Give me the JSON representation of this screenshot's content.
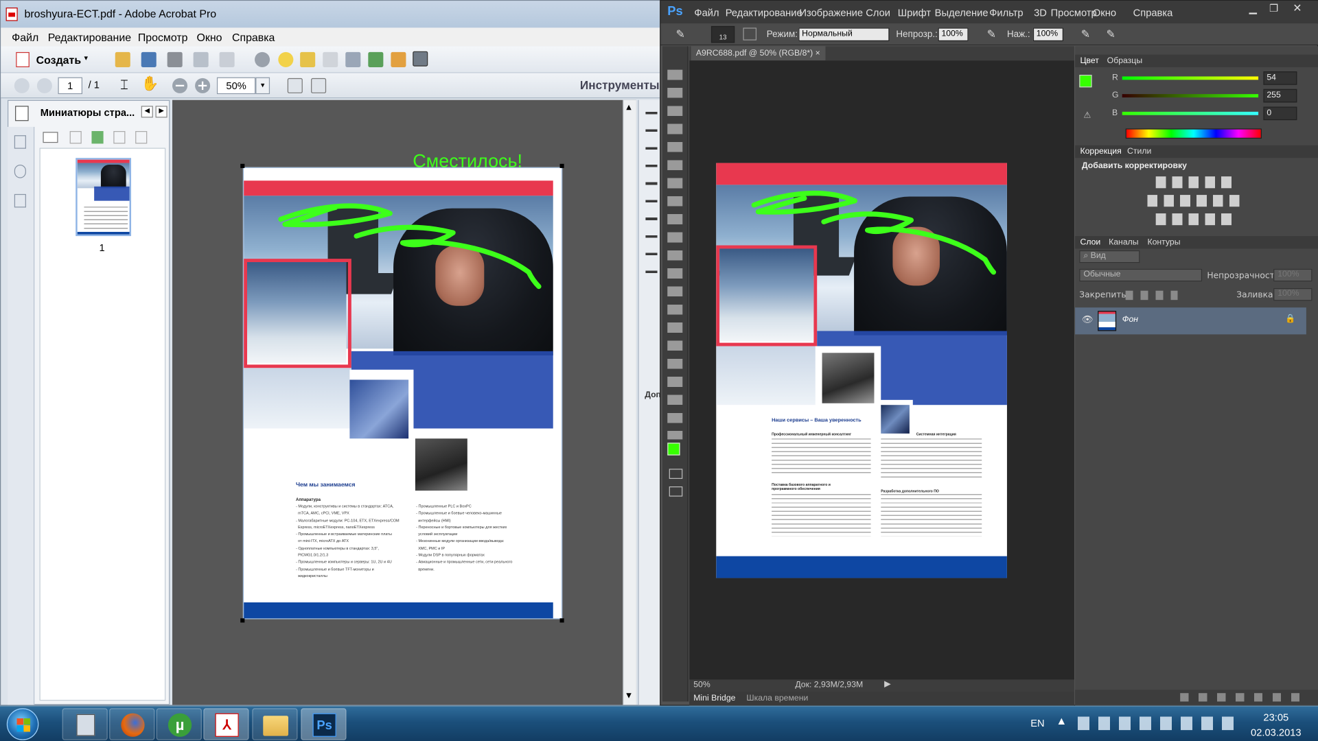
{
  "acrobat": {
    "title": "broshyura-ECT.pdf - Adobe Acrobat Pro",
    "menu": [
      "Файл",
      "Редактирование",
      "Просмотр",
      "Окно",
      "Справка"
    ],
    "create_label": "Создать",
    "page_current": "1",
    "page_total": "/ 1",
    "zoom": "50%",
    "tools_label": "Инструменты",
    "thumbnails_title": "Миниатюры стра...",
    "thumb_page_number": "1",
    "annotation": "Сместилось!",
    "right_pane_letter": "Доп"
  },
  "brochure": {
    "left_heading": "Чем мы занимаемся",
    "left_subheading": "Аппаратура",
    "left_col1": [
      "- Модули, конструктивы и системы в стандартах: ATCA,",
      "  mTCA, AMC, cPCI, VME, VPX",
      "- Малогабаритные модули: PC-104, ETX, ETXexpress/COM",
      "  Express, microETXexpress, nanoETXexpress",
      "- Промышленные и встраиваемые материнские платы",
      "  от mini-ITX, microATX до ATX",
      "- Одноплатные компьютеры в стандартах: 3,5\",",
      "  PICMG1.0/1.2/1.3",
      "- Промышленные компьютеры и серверы: 1U, 2U и 4U",
      "- Промышленные и боевые TFT-мониторы и",
      "  жидкокристаллы"
    ],
    "left_col2": [
      "- Промышленные PLC и BoxPC",
      "- Промышленные и боевые человеко-машинные",
      "  интерфейсы (HMI)",
      "- Переносные и бортовые компьютеры для жестких",
      "  условий эксплуатации",
      "- Мезонинные модули организации ввода/вывода:",
      "  XMC, PMC и IP",
      "- Модули DSP в популярных форматах",
      "- Авиационные и промышленные сети, сети реального",
      "  времени."
    ],
    "right_heading": "Наши сервисы – Ваша уверенность",
    "right_sections": [
      {
        "title": "Профессиональный инженерный консалтинг",
        "lines": 8
      },
      {
        "title": "Системная интеграция",
        "lines": 9
      },
      {
        "title": "Поставка базового аппаратного и программного обеспечения",
        "lines": 9
      },
      {
        "title": "Разработка дополнительного ПО",
        "lines": 9
      }
    ]
  },
  "photoshop": {
    "logo": "Ps",
    "menu": [
      "Файл",
      "Редактирование",
      "Изображение",
      "Слои",
      "Шрифт",
      "Выделение",
      "Фильтр",
      "3D",
      "Просмотр",
      "Окно",
      "Справка"
    ],
    "brush_size": "13",
    "mode_label": "Режим:",
    "mode_value": "Нормальный",
    "opacity_label": "Непрозр.:",
    "opacity_value": "100%",
    "flow_label": "Наж.:",
    "flow_value": "100%",
    "doc_tab": "A9RC688.pdf @ 50% (RGB/8*)",
    "status_zoom": "50%",
    "status_doc": "Док: 2,93M/2,93M",
    "bottom_tabs": [
      "Mini Bridge",
      "Шкала времени"
    ],
    "color_tabs": [
      "Цвет",
      "Образцы"
    ],
    "rgb": [
      {
        "label": "R",
        "value": "54"
      },
      {
        "label": "G",
        "value": "255"
      },
      {
        "label": "B",
        "value": "0"
      }
    ],
    "adj_tabs": [
      "Коррекция",
      "Стили"
    ],
    "adj_title": "Добавить корректировку",
    "layers_tabs": [
      "Слои",
      "Каналы",
      "Контуры"
    ],
    "layers_filter": "Вид",
    "blend_mode": "Обычные",
    "layer_opacity_label": "Непрозрачность:",
    "layer_opacity_value": "100%",
    "lock_label": "Закрепить:",
    "fill_label": "Заливка:",
    "fill_value": "100%",
    "layer_name": "Фон",
    "fg_color": "#36ff00"
  },
  "taskbar": {
    "lang": "EN",
    "time": "23:05",
    "date": "02.03.2013"
  }
}
